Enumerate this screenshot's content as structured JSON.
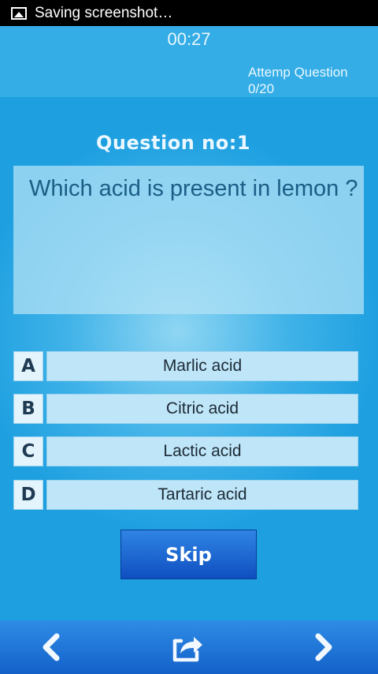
{
  "status_bar": {
    "text": "Saving screenshot…",
    "icon": "image-icon"
  },
  "header": {
    "timer": "00:27",
    "attempt_label": "Attemp Question",
    "attempt_count": "0/20"
  },
  "question": {
    "heading": "Question no:1",
    "text": "Which acid is present in lemon ?"
  },
  "options": [
    {
      "letter": "A",
      "text": "Marlic acid"
    },
    {
      "letter": "B",
      "text": "Citric acid"
    },
    {
      "letter": "C",
      "text": "Lactic acid"
    },
    {
      "letter": "D",
      "text": "Tartaric acid"
    }
  ],
  "skip_label": "Skip",
  "bottom_nav": {
    "left_icon": "chevron-left-icon",
    "center_icon": "share-icon",
    "right_icon": "chevron-right-icon"
  },
  "colors": {
    "background": "#1d9fe0",
    "skip_button": "#1560cf",
    "status_bar": "#000000"
  }
}
